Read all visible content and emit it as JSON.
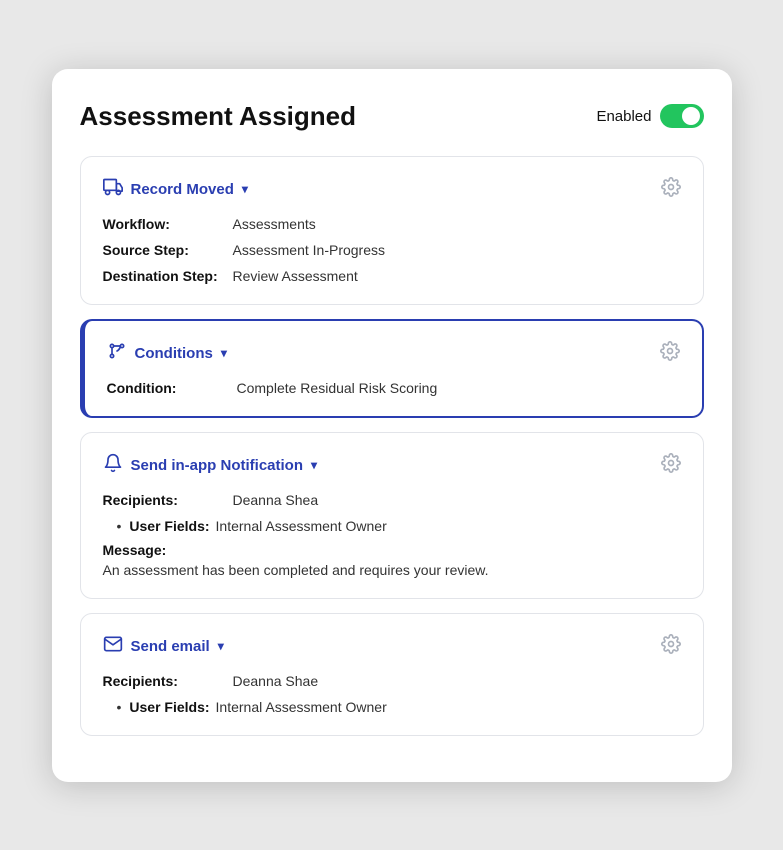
{
  "header": {
    "title": "Assessment Assigned",
    "enabled_label": "Enabled",
    "toggle_state": "on"
  },
  "cards": {
    "record_moved": {
      "trigger_label": "Record Moved",
      "chevron": "▾",
      "workflow_label": "Workflow:",
      "workflow_value": "Assessments",
      "source_label": "Source Step:",
      "source_value": "Assessment In-Progress",
      "destination_label": "Destination Step:",
      "destination_value": "Review Assessment"
    },
    "conditions": {
      "trigger_label": "Conditions",
      "chevron": "▾",
      "condition_label": "Condition:",
      "condition_value": "Complete Residual Risk Scoring"
    },
    "notification": {
      "trigger_label": "Send in-app Notification",
      "chevron": "▾",
      "recipients_label": "Recipients:",
      "recipients_value": "Deanna Shea",
      "user_fields_label": "User Fields:",
      "user_fields_value": "Internal Assessment Owner",
      "message_label": "Message:",
      "message_value": "An assessment has been completed and requires your review."
    },
    "email": {
      "trigger_label": "Send email",
      "chevron": "▾",
      "recipients_label": "Recipients:",
      "recipients_value": "Deanna Shae",
      "user_fields_label": "User Fields:",
      "user_fields_value": "Internal Assessment Owner"
    }
  },
  "icons": {
    "record_moved": "truck",
    "conditions": "branch",
    "notification": "bell",
    "email": "envelope",
    "gear": "gear"
  }
}
